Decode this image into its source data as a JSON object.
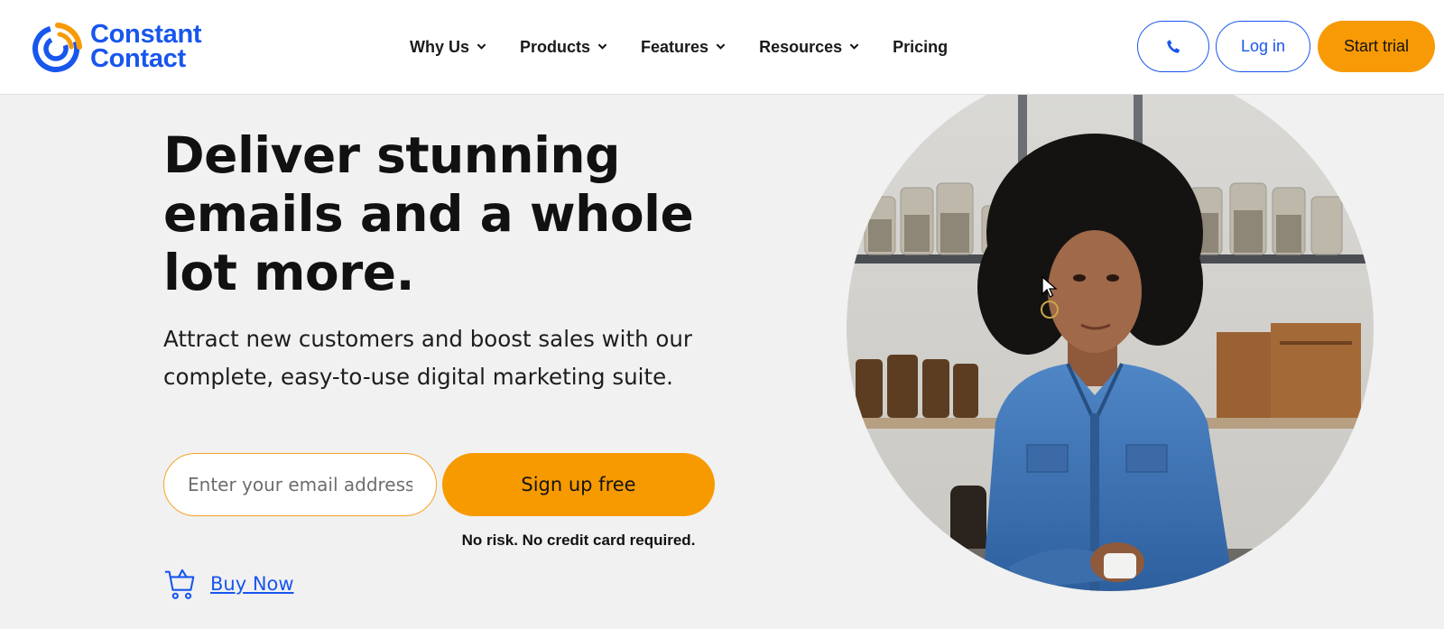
{
  "header": {
    "logo": {
      "line1": "Constant",
      "line2": "Contact"
    },
    "nav": [
      {
        "label": "Why Us",
        "has_dropdown": true
      },
      {
        "label": "Products",
        "has_dropdown": true
      },
      {
        "label": "Features",
        "has_dropdown": true
      },
      {
        "label": "Resources",
        "has_dropdown": true
      },
      {
        "label": "Pricing",
        "has_dropdown": false
      }
    ],
    "phone_icon": "phone-icon",
    "login_label": "Log in",
    "trial_label": "Start trial"
  },
  "hero": {
    "title": "Deliver stunning emails and a whole lot more.",
    "subtitle": "Attract new customers and boost sales with our complete, easy-to-use digital marketing suite.",
    "email_placeholder": "Enter your email address",
    "email_value": "",
    "signup_label": "Sign up free",
    "no_risk": "No risk. No credit card required.",
    "buy_now_label": "Buy Now",
    "buy_now_icon": "cart-icon",
    "image_alt": "woman-in-denim-shirt-photo"
  },
  "colors": {
    "brand_blue": "#1856ed",
    "accent_orange": "#f89a05",
    "background": "#f1f1f1",
    "header_bg": "#ffffff"
  }
}
